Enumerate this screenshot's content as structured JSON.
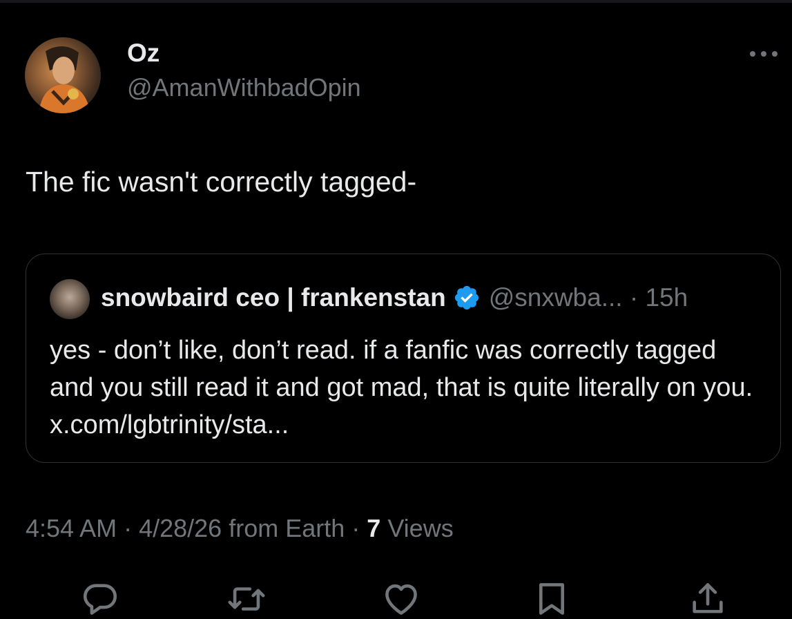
{
  "author": {
    "name": "Oz",
    "handle": "@AmanWithbadOpin"
  },
  "tweet": {
    "text": "The fic wasn't correctly tagged-"
  },
  "quoted": {
    "name": "snowbaird ceo | frankenstan",
    "handle": "@snxwba...",
    "separator": " · ",
    "time": "15h",
    "text": "yes - don’t like, don’t read. if a fanfic was correctly tagged and you still read it and got mad, that is quite literally on you. x.com/lgbtrinity/sta...",
    "verified_color": "#1d9bf0"
  },
  "meta": {
    "time": "4:54 AM",
    "dot1": " · ",
    "date": "4/28/26",
    "source": " from Earth",
    "dot2": " · ",
    "views_count": "7",
    "views_label": " Views"
  },
  "icons": {
    "more": "more-icon",
    "reply": "reply-icon",
    "retweet": "retweet-icon",
    "like": "like-icon",
    "bookmark": "bookmark-icon",
    "share": "share-icon",
    "verified": "verified-badge-icon"
  },
  "colors": {
    "background": "#000000",
    "text": "#e7e9ea",
    "secondary": "#71767b",
    "border": "#2f3336",
    "accent": "#1d9bf0"
  }
}
